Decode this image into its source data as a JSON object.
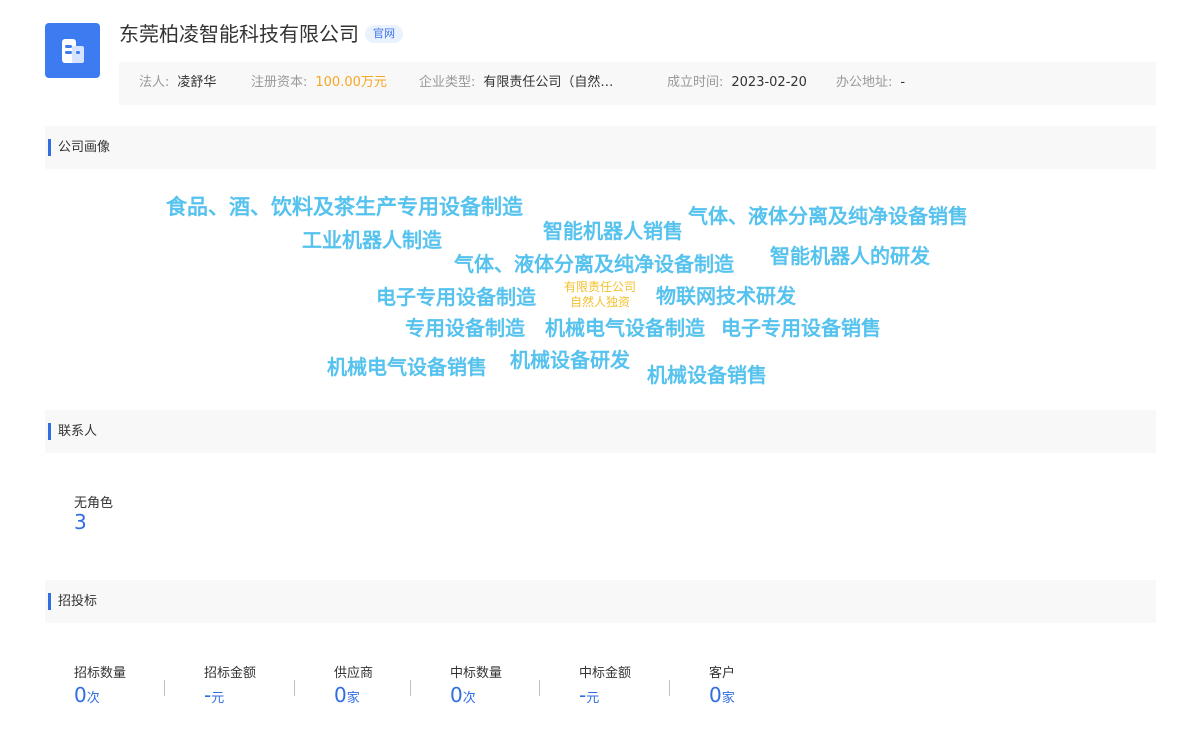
{
  "header": {
    "company_name": "东莞柏凌智能科技有限公司",
    "website_tag": "官网",
    "logo_icon": "building-icon",
    "brand_color": "#3d7cf0"
  },
  "info": {
    "legal_person_label": "法人:",
    "legal_person": "凌舒华",
    "capital_label": "注册资本:",
    "capital": "100.00万元",
    "type_label": "企业类型:",
    "type": "有限责任公司（自然…",
    "established_label": "成立时间:",
    "established": "2023-02-20",
    "address_label": "办公地址:",
    "address": "-"
  },
  "sections": {
    "profile": "公司画像",
    "contacts": "联系人",
    "bidding": "招投标"
  },
  "word_cloud": [
    "食品、酒、饮料及茶生产专用设备制造",
    "智能机器人销售",
    "气体、液体分离及纯净设备销售",
    "工业机器人制造",
    "气体、液体分离及纯净设备制造",
    "智能机器人的研发",
    "电子专用设备制造",
    "有限责任公司",
    "自然人独资",
    "物联网技术研发",
    "专用设备制造",
    "机械电气设备制造",
    "电子专用设备销售",
    "机械电气设备销售",
    "机械设备研发",
    "机械设备销售"
  ],
  "contacts": {
    "label": "无角色",
    "count": "3"
  },
  "bidding": [
    {
      "label": "招标数量",
      "value": "0",
      "unit": "次"
    },
    {
      "label": "招标金额",
      "value": "-",
      "unit": "元"
    },
    {
      "label": "供应商",
      "value": "0",
      "unit": "家"
    },
    {
      "label": "中标数量",
      "value": "0",
      "unit": "次"
    },
    {
      "label": "中标金额",
      "value": "-",
      "unit": "元"
    },
    {
      "label": "客户",
      "value": "0",
      "unit": "家"
    }
  ]
}
